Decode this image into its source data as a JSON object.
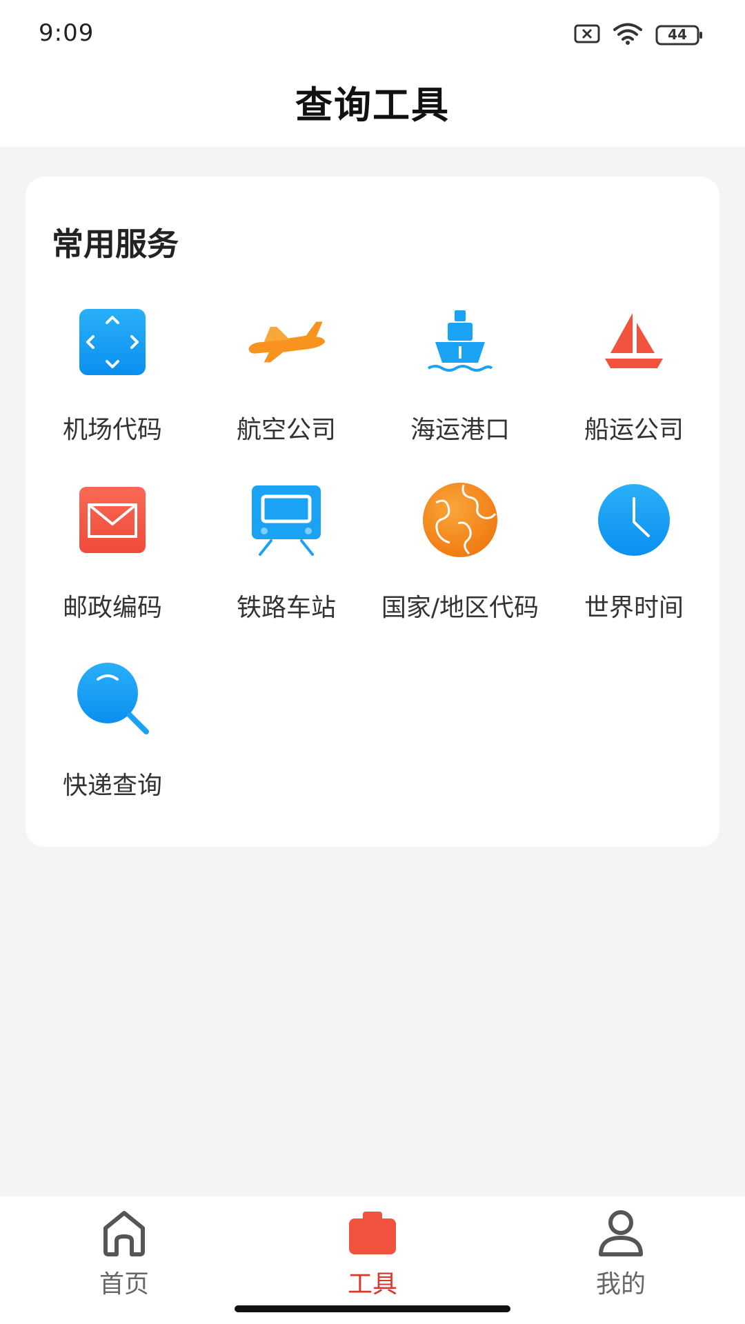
{
  "status": {
    "time": "9:09",
    "battery": "44",
    "icons": [
      "sim-off-icon",
      "wifi-icon",
      "battery-icon"
    ]
  },
  "header": {
    "title": "查询工具"
  },
  "section": {
    "title": "常用服务",
    "items": [
      {
        "label": "机场代码",
        "icon": "airport-code-icon"
      },
      {
        "label": "航空公司",
        "icon": "airplane-icon"
      },
      {
        "label": "海运港口",
        "icon": "ship-icon"
      },
      {
        "label": "船运公司",
        "icon": "sailboat-icon"
      },
      {
        "label": "邮政编码",
        "icon": "envelope-icon"
      },
      {
        "label": "铁路车站",
        "icon": "train-icon"
      },
      {
        "label": "国家/地区代码",
        "icon": "globe-icon"
      },
      {
        "label": "世界时间",
        "icon": "clock-icon"
      },
      {
        "label": "快递查询",
        "icon": "search-icon"
      }
    ]
  },
  "tabbar": {
    "tabs": [
      {
        "label": "首页",
        "icon": "home-icon"
      },
      {
        "label": "工具",
        "icon": "toolbox-icon",
        "active": true
      },
      {
        "label": "我的",
        "icon": "user-icon"
      }
    ]
  },
  "colors": {
    "accent": "#d6392f",
    "blue": "#1aa3f5",
    "orange": "#f7931e",
    "red": "#f2533f"
  }
}
